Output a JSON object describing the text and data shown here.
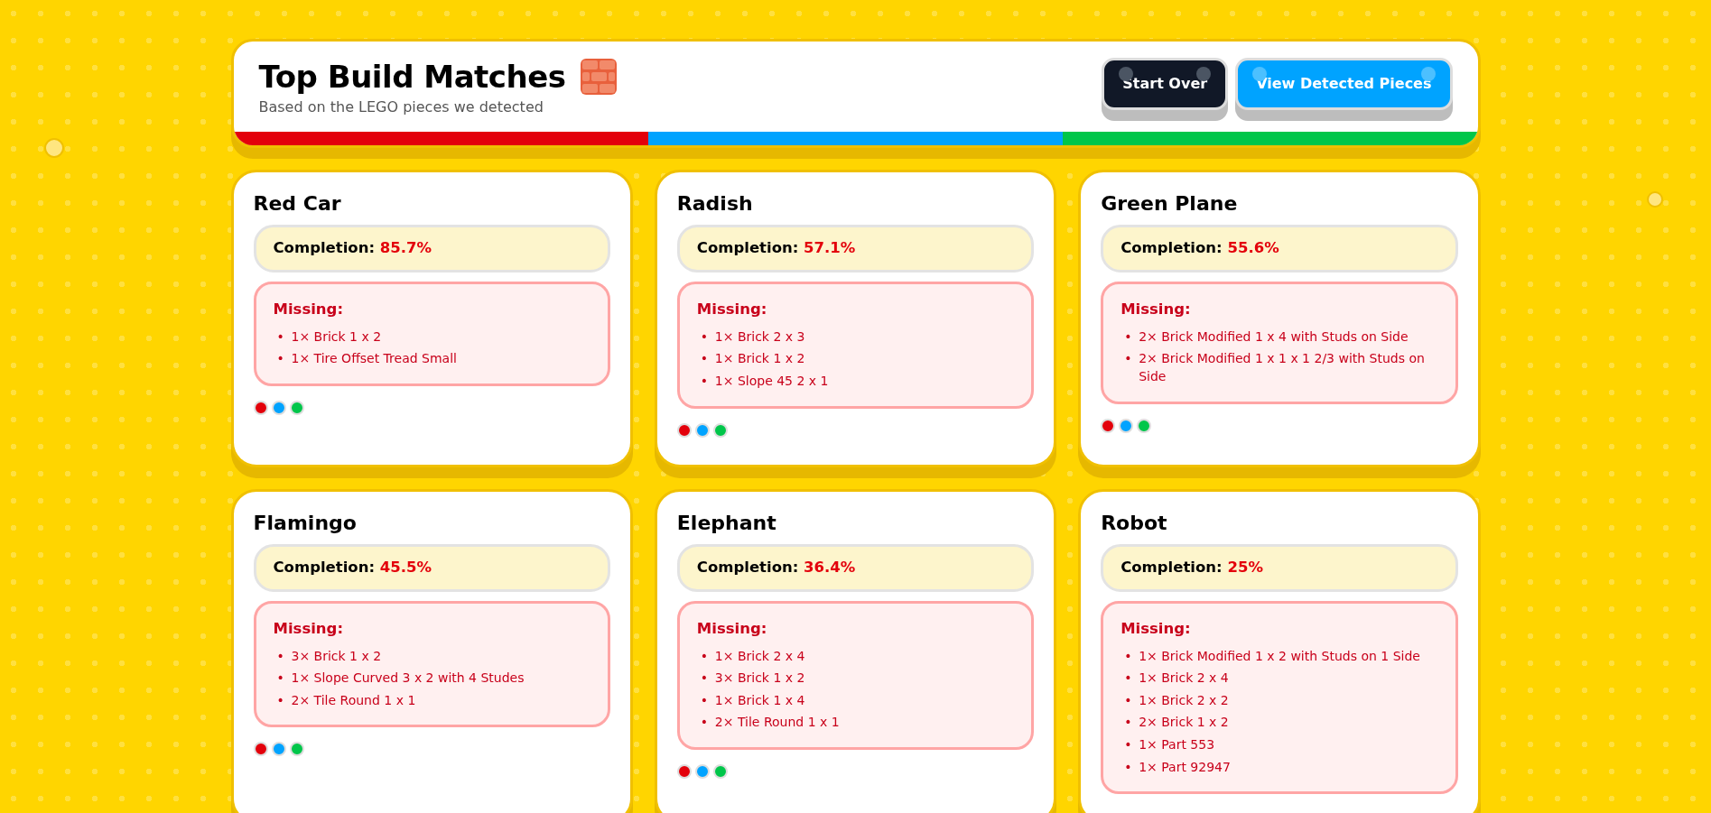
{
  "header": {
    "title": "Top Build Matches",
    "subtitle": "Based on the LEGO pieces we detected",
    "buttons": [
      {
        "label": "Start Over",
        "kind": "dark"
      },
      {
        "label": "View Detected Pieces",
        "kind": "blue"
      }
    ],
    "stripe": [
      {
        "color": "#e3000b"
      },
      {
        "color": "#00a3ff"
      },
      {
        "color": "#00c64a"
      }
    ]
  },
  "cards": [
    {
      "title": "Red Car",
      "completion_label": "Completion:",
      "completion": "85.7%",
      "missing_label": "Missing:",
      "missing": [
        {
          "marker": "•",
          "text": "1× Brick 1 x 2"
        },
        {
          "marker": "•",
          "text": "1× Tire Offset Tread Small"
        }
      ],
      "dots": [
        {
          "color": "#e3000b"
        },
        {
          "color": "#00a3ff"
        },
        {
          "color": "#00c64a"
        }
      ]
    },
    {
      "title": "Radish",
      "completion_label": "Completion:",
      "completion": "57.1%",
      "missing_label": "Missing:",
      "missing": [
        {
          "marker": "•",
          "text": "1× Brick 2 x 3"
        },
        {
          "marker": "•",
          "text": "1× Brick 1 x 2"
        },
        {
          "marker": "•",
          "text": "1× Slope 45 2 x 1"
        }
      ],
      "dots": [
        {
          "color": "#e3000b"
        },
        {
          "color": "#00a3ff"
        },
        {
          "color": "#00c64a"
        }
      ]
    },
    {
      "title": "Green Plane",
      "completion_label": "Completion:",
      "completion": "55.6%",
      "missing_label": "Missing:",
      "missing": [
        {
          "marker": "•",
          "text": "2× Brick Modified 1 x 4 with Studs on Side"
        },
        {
          "marker": "•",
          "text": "2× Brick Modified 1 x 1 x 1 2/3 with Studs on Side"
        }
      ],
      "dots": [
        {
          "color": "#e3000b"
        },
        {
          "color": "#00a3ff"
        },
        {
          "color": "#00c64a"
        }
      ]
    },
    {
      "title": "Flamingo",
      "completion_label": "Completion:",
      "completion": "45.5%",
      "missing_label": "Missing:",
      "missing": [
        {
          "marker": "•",
          "text": "3× Brick 1 x 2"
        },
        {
          "marker": "•",
          "text": "1× Slope Curved 3 x 2 with 4 Studes"
        },
        {
          "marker": "•",
          "text": "2× Tile Round 1 x 1"
        }
      ],
      "dots": [
        {
          "color": "#e3000b"
        },
        {
          "color": "#00a3ff"
        },
        {
          "color": "#00c64a"
        }
      ]
    },
    {
      "title": "Elephant",
      "completion_label": "Completion:",
      "completion": "36.4%",
      "missing_label": "Missing:",
      "missing": [
        {
          "marker": "•",
          "text": "1× Brick 2 x 4"
        },
        {
          "marker": "•",
          "text": "3× Brick 1 x 2"
        },
        {
          "marker": "•",
          "text": "1× Brick 1 x 4"
        },
        {
          "marker": "•",
          "text": "2× Tile Round 1 x 1"
        }
      ],
      "dots": [
        {
          "color": "#e3000b"
        },
        {
          "color": "#00a3ff"
        },
        {
          "color": "#00c64a"
        }
      ]
    },
    {
      "title": "Robot",
      "completion_label": "Completion:",
      "completion": "25%",
      "missing_label": "Missing:",
      "missing": [
        {
          "marker": "•",
          "text": "1× Brick Modified 1 x 2 with Studs on 1 Side"
        },
        {
          "marker": "•",
          "text": "1× Brick 2 x 4"
        },
        {
          "marker": "•",
          "text": "1× Brick 2 x 2"
        },
        {
          "marker": "•",
          "text": "2× Brick 1 x 2"
        },
        {
          "marker": "•",
          "text": "1× Part 553"
        },
        {
          "marker": "•",
          "text": "1× Part 92947"
        }
      ]
    }
  ]
}
